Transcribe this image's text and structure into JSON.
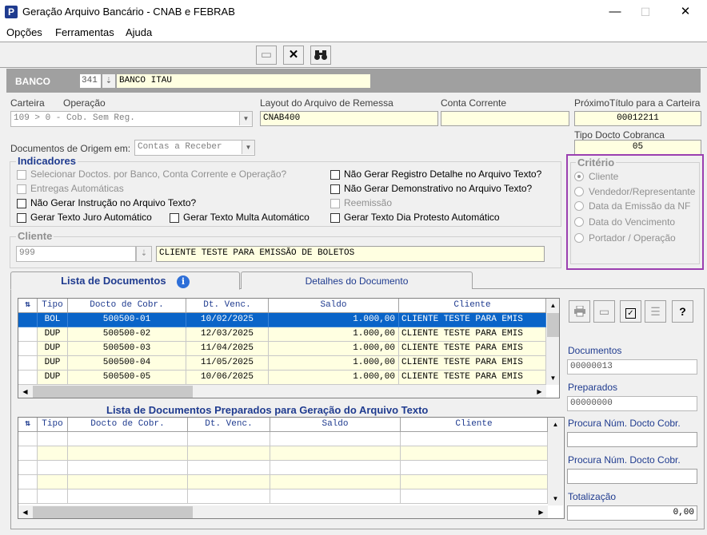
{
  "window": {
    "title": "Geração Arquivo Bancário - CNAB e FEBRAB",
    "min": "—",
    "max": "☐",
    "close": "✕"
  },
  "menu": {
    "opcoes": "Opções",
    "ferramentas": "Ferramentas",
    "ajuda": "Ajuda"
  },
  "toolbar": {
    "new_icon": "▭",
    "delete_icon": "✕",
    "search_icon": "⚲"
  },
  "banco": {
    "label": "BANCO",
    "code": "341",
    "name": "BANCO ITAU"
  },
  "fields": {
    "carteira_label": "Carteira",
    "operacao_label": "Operação",
    "carteira_value": "109   > 0 - Cob. Sem Reg.",
    "layout_label": "Layout do Arquivo de Remessa",
    "layout_value": "CNAB400",
    "conta_label": "Conta Corrente",
    "conta_value": "",
    "proximo_label": "PróximoTítulo para a Carteira",
    "proximo_value": "00012211",
    "tipo_docto_label": "Tipo Docto Cobranca",
    "tipo_docto_value": "05",
    "docs_origem_label": "Documentos de Origem em:",
    "docs_origem_value": "Contas a Receber"
  },
  "indicadores": {
    "title": "Indicadores",
    "left": [
      {
        "label": "Selecionar Doctos. por Banco, Conta Corrente  e Operação?",
        "enabled": false
      },
      {
        "label": "Entregas Automáticas",
        "enabled": false
      },
      {
        "label": "Não Gerar Instrução no Arquivo Texto?",
        "enabled": true
      },
      {
        "label": "Gerar Texto Juro Automático",
        "enabled": true
      }
    ],
    "multa": "Gerar Texto Multa Automático",
    "right": [
      {
        "label": "Não Gerar Registro Detalhe no Arquivo Texto?",
        "enabled": true
      },
      {
        "label": "Não Gerar Demonstrativo no Arquivo Texto?",
        "enabled": true
      },
      {
        "label": "Reemissão",
        "enabled": false
      },
      {
        "label": "Gerar Texto Dia Protesto Automático",
        "enabled": true
      }
    ]
  },
  "criterio": {
    "title": "Critério",
    "options": [
      "Cliente",
      "Vendedor/Representante",
      "Data da Emissão da NF",
      "Data do Vencimento",
      "Portador / Operação"
    ],
    "selected": 0
  },
  "cliente": {
    "title": "Cliente",
    "code": "999",
    "name": "CLIENTE TESTE PARA EMISSÃO DE BOLETOS"
  },
  "tabs": {
    "lista": "Lista de Documentos",
    "detalhes": "Detalhes do Documento"
  },
  "grid_columns": [
    "Tipo",
    "Docto de Cobr.",
    "Dt. Venc.",
    "Saldo",
    "Cliente"
  ],
  "documentos": [
    {
      "tipo": "BOL",
      "docto": "500500-01",
      "venc": "10/02/2025",
      "saldo": "1.000,00",
      "cliente": "CLIENTE TESTE PARA EMIS"
    },
    {
      "tipo": "DUP",
      "docto": "500500-02",
      "venc": "12/03/2025",
      "saldo": "1.000,00",
      "cliente": "CLIENTE TESTE PARA EMIS"
    },
    {
      "tipo": "DUP",
      "docto": "500500-03",
      "venc": "11/04/2025",
      "saldo": "1.000,00",
      "cliente": "CLIENTE TESTE PARA EMIS"
    },
    {
      "tipo": "DUP",
      "docto": "500500-04",
      "venc": "11/05/2025",
      "saldo": "1.000,00",
      "cliente": "CLIENTE TESTE PARA EMIS"
    },
    {
      "tipo": "DUP",
      "docto": "500500-05",
      "venc": "10/06/2025",
      "saldo": "1.000,00",
      "cliente": "CLIENTE TESTE PARA EMIS"
    }
  ],
  "preparados_title": "Lista de Documentos Preparados para Geração do Arquivo Texto",
  "side": {
    "documentos_label": "Documentos",
    "documentos_value": "00000013",
    "preparados_label": "Preparados",
    "preparados_value": "00000000",
    "procura1_label": "Procura Núm. Docto Cobr.",
    "procura1_value": "",
    "procura2_label": "Procura Núm. Docto Cobr.",
    "procura2_value": "",
    "totalizacao_label": "Totalização",
    "totalizacao_value": "0,00",
    "help": "?"
  },
  "colors": {
    "accent": "#1f3b8f",
    "selected_row": "#0a64c8",
    "field_yellow": "#ffffe1",
    "criterio_border": "#9b3fb0"
  }
}
